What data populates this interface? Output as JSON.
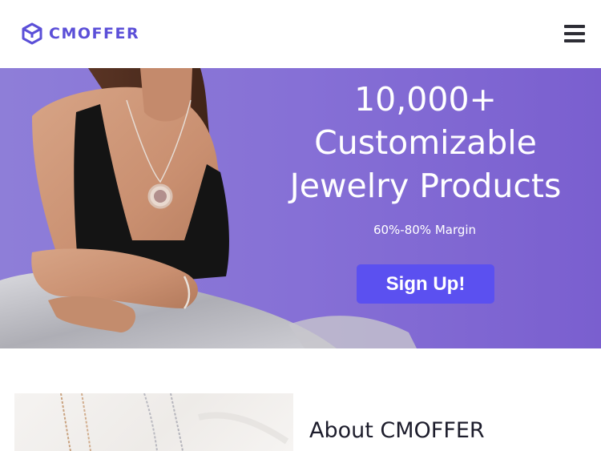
{
  "header": {
    "brand": "CMOFFER",
    "logo_icon": "cube-logo-icon",
    "menu_icon": "hamburger-menu-icon"
  },
  "hero": {
    "title_lines": [
      "10,000+",
      "Customizable",
      "Jewelry Products"
    ],
    "subtitle": "60%-80% Margin",
    "cta_label": "Sign Up!",
    "image": "woman-wearing-pendant-necklace-photo"
  },
  "about": {
    "title": "About CMOFFER",
    "image": "necklace-chains-photo"
  },
  "colors": {
    "brand": "#5b4fd8",
    "hero_background": "#8670d6",
    "cta_background": "#5b50f0",
    "text_dark": "#1d1d2c"
  }
}
